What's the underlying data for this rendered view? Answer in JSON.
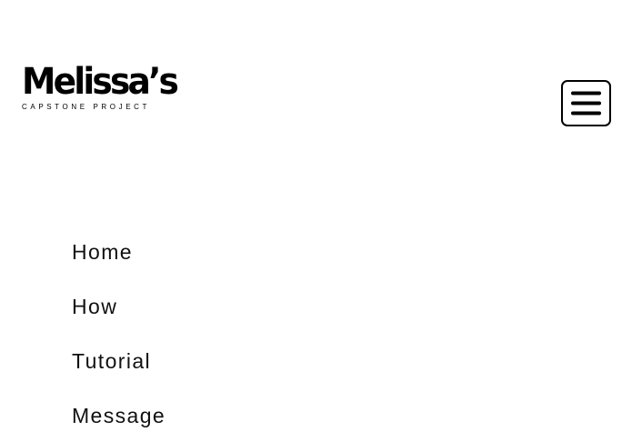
{
  "header": {
    "logo": {
      "title": "Melissa’s",
      "subtitle": "CAPSTONE PROJECT"
    },
    "menu_button": {
      "icon": "hamburger-menu-icon"
    }
  },
  "nav": {
    "items": [
      {
        "label": "Home"
      },
      {
        "label": "How"
      },
      {
        "label": "Tutorial"
      },
      {
        "label": "Message"
      }
    ]
  },
  "colors": {
    "background": "#ffffff",
    "text": "#111111",
    "logo": "#000000"
  }
}
